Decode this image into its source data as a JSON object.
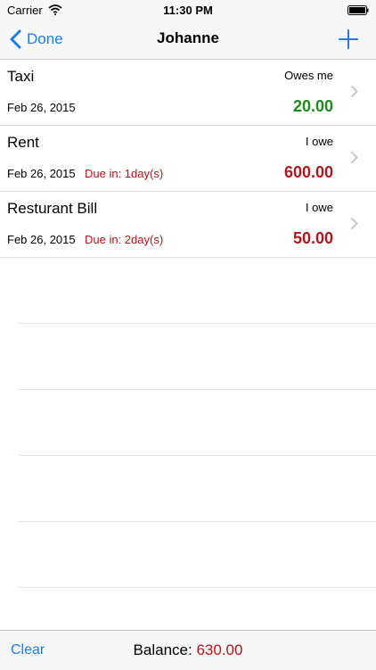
{
  "status_bar": {
    "carrier": "Carrier",
    "time": "11:30 PM",
    "wifi_icon": "wifi-icon",
    "battery_icon": "battery-icon"
  },
  "nav": {
    "back_label": "Done",
    "title": "Johanne",
    "add_icon": "plus-icon"
  },
  "colors": {
    "accent": "#1b7ee6",
    "positive": "#1e8a1e",
    "negative": "#b0161b"
  },
  "entries": [
    {
      "title": "Taxi",
      "relation": "Owes me",
      "date": "Feb 26, 2015",
      "due": "",
      "amount": "20.00",
      "amount_color": "#1e8a1e"
    },
    {
      "title": "Rent",
      "relation": "I owe",
      "date": "Feb 26, 2015",
      "due": "Due in: 1day(s)",
      "amount": "600.00",
      "amount_color": "#b0161b"
    },
    {
      "title": "Resturant Bill",
      "relation": "I owe",
      "date": "Feb 26, 2015",
      "due": "Due in: 2day(s)",
      "amount": "50.00",
      "amount_color": "#b0161b"
    }
  ],
  "toolbar": {
    "clear_label": "Clear",
    "balance_label": "Balance:",
    "balance_value": "630.00"
  }
}
